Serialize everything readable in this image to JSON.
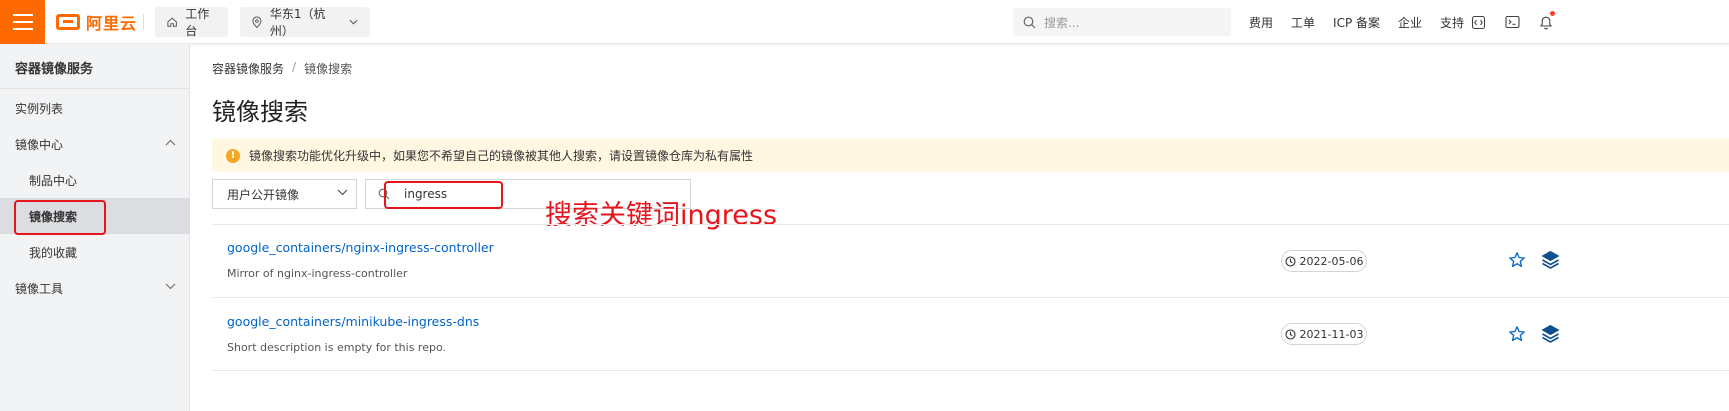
{
  "topbar": {
    "logo_text": "阿里云",
    "workbench": "工作台",
    "region": "华东1（杭州）",
    "search_placeholder": "搜索...",
    "links": [
      "费用",
      "工单",
      "ICP 备案",
      "企业",
      "支持"
    ],
    "icons": [
      "code-icon",
      "terminal-icon",
      "bell-icon"
    ]
  },
  "sidebar": {
    "title": "容器镜像服务",
    "items": [
      {
        "label": "实例列表"
      },
      {
        "label": "镜像中心"
      },
      {
        "label": "制品中心"
      },
      {
        "label": "镜像搜索"
      },
      {
        "label": "我的收藏"
      },
      {
        "label": "镜像工具"
      }
    ]
  },
  "breadcrumb": {
    "root": "容器镜像服务",
    "separator": "/",
    "current": "镜像搜索"
  },
  "page": {
    "title": "镜像搜索",
    "notice": "镜像搜索功能优化升级中，如果您不希望自己的镜像被其他人搜索，请设置镜像仓库为私有属性",
    "notice_icon": "!"
  },
  "filter": {
    "select_value": "用户公开镜像",
    "search_value": "ingress"
  },
  "annotation": "搜索关键词ingress",
  "results": [
    {
      "name": "google_containers/nginx-ingress-controller",
      "desc": "Mirror of nginx-ingress-controller",
      "date": "2022-05-06"
    },
    {
      "name": "google_containers/minikube-ingress-dns",
      "desc": "Short description is empty for this repo.",
      "date": "2021-11-03"
    }
  ],
  "colors": {
    "brand": "#ff6a00",
    "link": "#0064c8",
    "annotation_red": "#e4151d",
    "notice_bg": "#fff7e1"
  }
}
